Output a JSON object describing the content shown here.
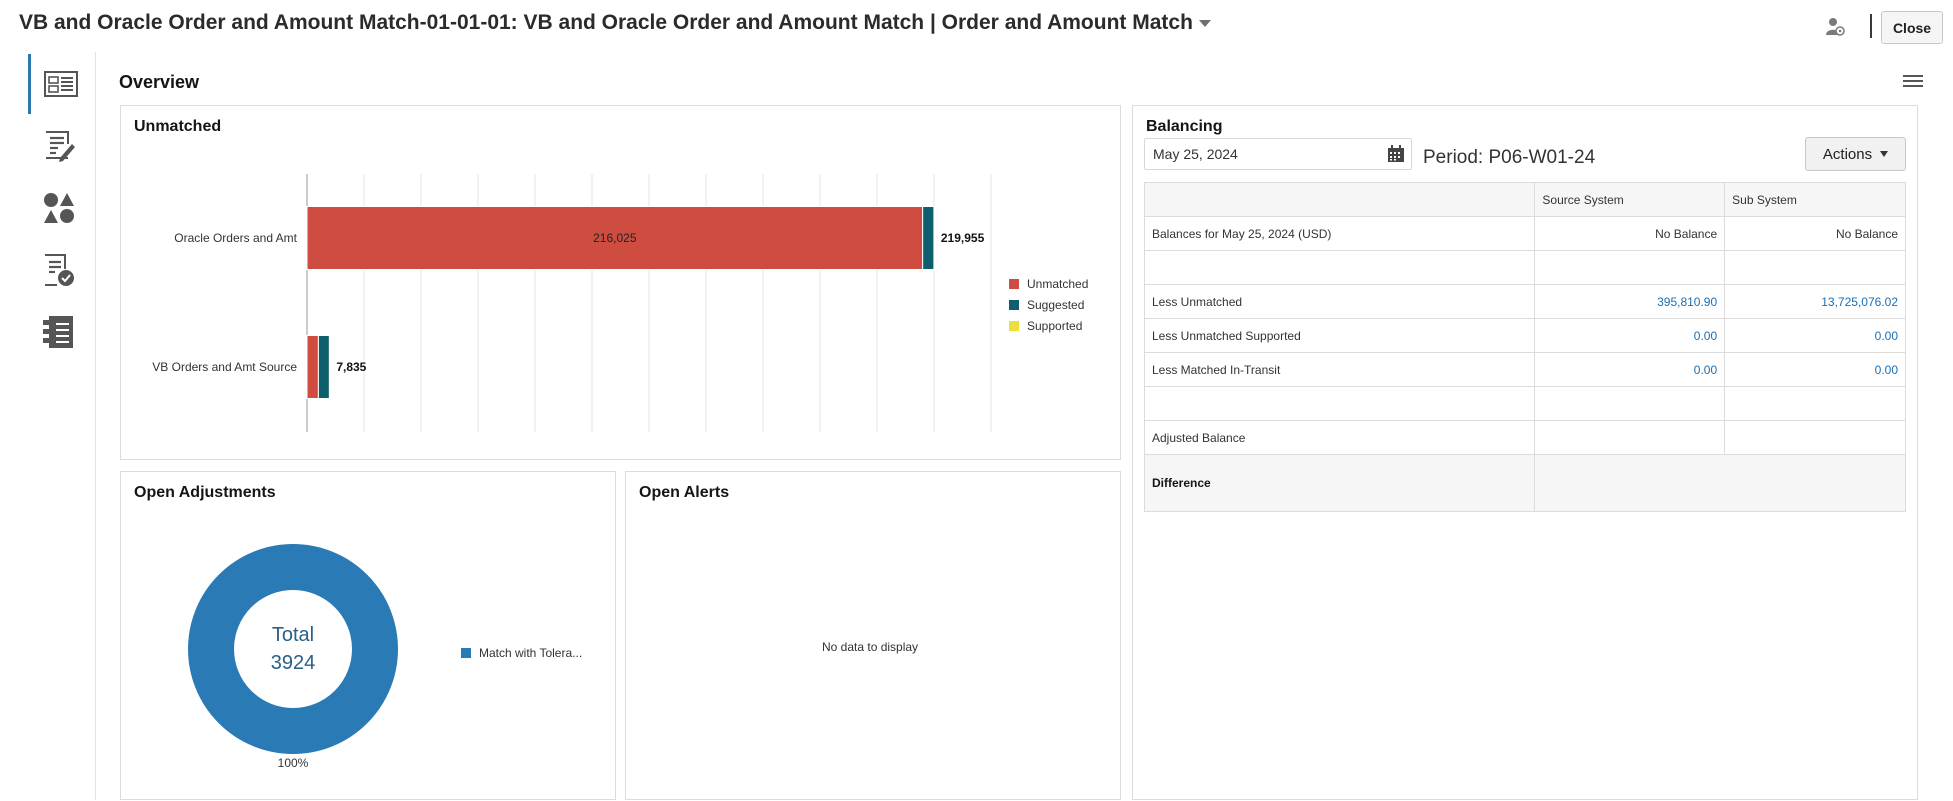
{
  "header": {
    "title": "VB and Oracle Order and Amount Match-01-01-01: VB and Oracle Order and Amount Match | Order and Amount Match",
    "close_label": "Close"
  },
  "rail": {
    "items": [
      {
        "icon": "overview-icon",
        "active": true
      },
      {
        "icon": "edit-list-icon",
        "active": false
      },
      {
        "icon": "shapes-icon",
        "active": false
      },
      {
        "icon": "document-check-icon",
        "active": false
      },
      {
        "icon": "checklist-icon",
        "active": false
      }
    ]
  },
  "overview": {
    "title": "Overview"
  },
  "unmatched": {
    "title": "Unmatched",
    "legend": [
      {
        "label": "Unmatched",
        "color": "#cf4d40"
      },
      {
        "label": "Suggested",
        "color": "#0d5f6e"
      },
      {
        "label": "Supported",
        "color": "#eadf3b"
      }
    ]
  },
  "chart_data": {
    "type": "bar",
    "orientation": "horizontal",
    "stacked": true,
    "categories": [
      "Oracle Orders and Amt",
      "VB Orders and Amt Source"
    ],
    "series": [
      {
        "name": "Unmatched",
        "values": [
          216025,
          4000
        ]
      },
      {
        "name": "Suggested",
        "values": [
          3930,
          3835
        ]
      },
      {
        "name": "Supported",
        "values": [
          0,
          0
        ]
      }
    ],
    "segment_labels": [
      "216,025",
      ""
    ],
    "totals": [
      "219,955",
      "7,835"
    ],
    "xlim": [
      0,
      240000
    ],
    "grid": true,
    "legend_position": "right"
  },
  "open_adjustments": {
    "title": "Open Adjustments",
    "total_label": "Total",
    "total_value": "3924",
    "percent_label": "100%",
    "legend": [
      {
        "label": "Match with Tolera...",
        "color": "#2a7ab5"
      }
    ]
  },
  "open_alerts": {
    "title": "Open Alerts",
    "empty_text": "No data to display"
  },
  "balancing": {
    "title": "Balancing",
    "date_value": "May 25, 2024",
    "period_text": "Period: P06-W01-24",
    "actions_label": "Actions",
    "columns": [
      "",
      "Source System",
      "Sub System"
    ],
    "rows": [
      {
        "label": "Balances for May 25, 2024 (USD)",
        "source": "No Balance",
        "sub": "No Balance",
        "link": false
      },
      {
        "label": "",
        "source": "",
        "sub": "",
        "link": false
      },
      {
        "label": "Less Unmatched",
        "source": "395,810.90",
        "sub": "13,725,076.02",
        "link": true
      },
      {
        "label": "Less Unmatched Supported",
        "source": "0.00",
        "sub": "0.00",
        "link": true
      },
      {
        "label": "Less Matched In-Transit",
        "source": "0.00",
        "sub": "0.00",
        "link": true
      },
      {
        "label": "",
        "source": "",
        "sub": "",
        "link": false
      },
      {
        "label": "Adjusted Balance",
        "source": "",
        "sub": "",
        "link": false
      }
    ],
    "difference_label": "Difference"
  }
}
